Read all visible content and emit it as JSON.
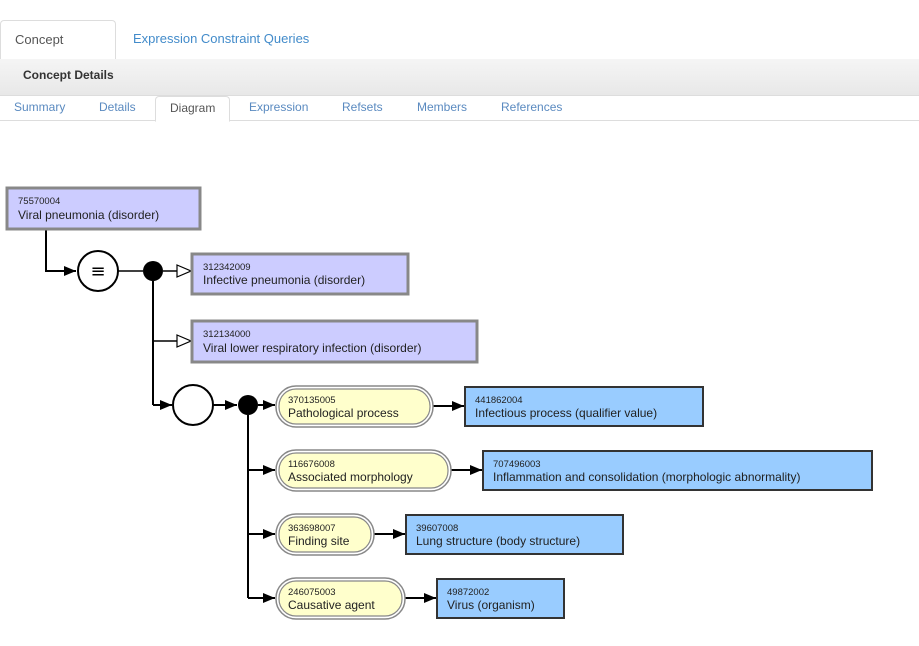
{
  "top_tabs": [
    {
      "label": "Concept Details",
      "active": true
    },
    {
      "label": "Expression Constraint Queries",
      "active": false
    }
  ],
  "panel": {
    "title": "Concept Details"
  },
  "sub_tabs": [
    {
      "label": "Summary",
      "active": false
    },
    {
      "label": "Details",
      "active": false
    },
    {
      "label": "Diagram",
      "active": true
    },
    {
      "label": "Expression",
      "active": false
    },
    {
      "label": "Refsets",
      "active": false
    },
    {
      "label": "Members",
      "active": false
    },
    {
      "label": "References",
      "active": false
    }
  ],
  "colors": {
    "defined_concept_fill": "#ccccff",
    "defined_concept_border": "#888888",
    "attribute_fill": "#ffffcc",
    "value_fill": "#99ccff",
    "value_border": "#333333",
    "link": "#428bca"
  },
  "diagram": {
    "focus": {
      "id": "75570004",
      "term": "Viral pneumonia (disorder)"
    },
    "definition_status_symbol": "≡",
    "parents": [
      {
        "id": "312342009",
        "term": "Infective pneumonia (disorder)"
      },
      {
        "id": "312134000",
        "term": "Viral lower respiratory infection (disorder)"
      }
    ],
    "relationships": [
      {
        "attribute": {
          "id": "370135005",
          "term": "Pathological process"
        },
        "value": {
          "id": "441862004",
          "term": "Infectious process (qualifier value)"
        }
      },
      {
        "attribute": {
          "id": "116676008",
          "term": "Associated morphology"
        },
        "value": {
          "id": "707496003",
          "term": "Inflammation and consolidation (morphologic abnormality)"
        }
      },
      {
        "attribute": {
          "id": "363698007",
          "term": "Finding site"
        },
        "value": {
          "id": "39607008",
          "term": "Lung structure (body structure)"
        }
      },
      {
        "attribute": {
          "id": "246075003",
          "term": "Causative agent"
        },
        "value": {
          "id": "49872002",
          "term": "Virus (organism)"
        }
      }
    ]
  }
}
